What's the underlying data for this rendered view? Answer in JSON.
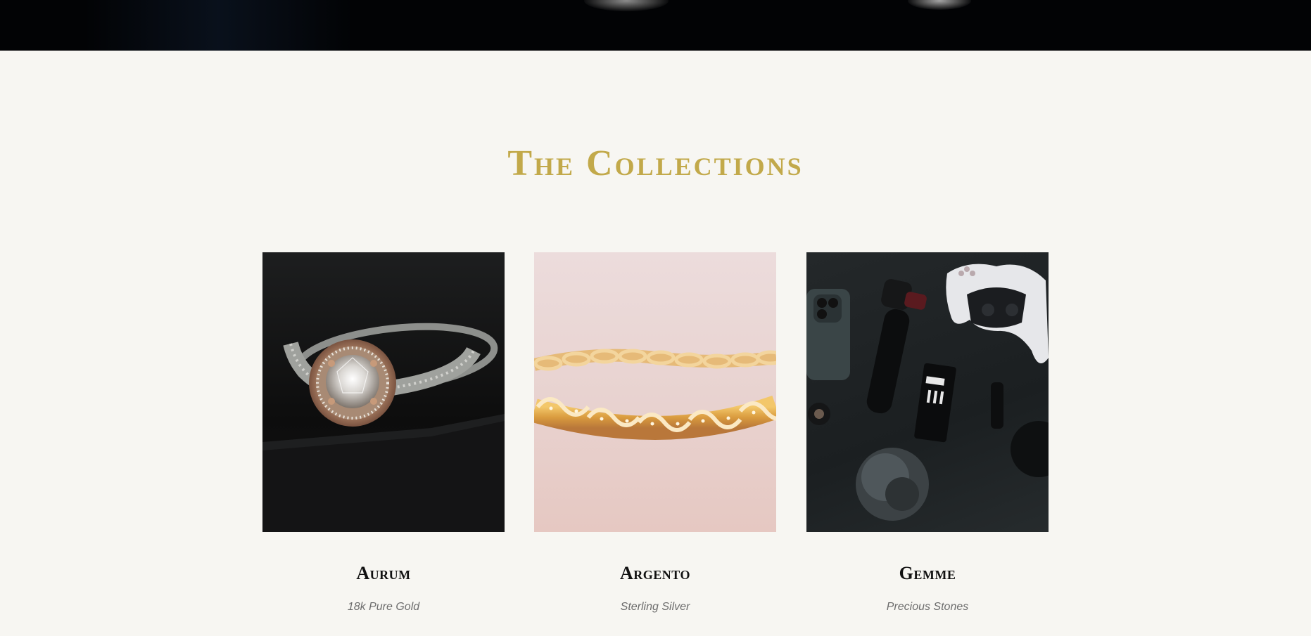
{
  "section": {
    "title": "The Collections"
  },
  "collections": [
    {
      "name": "Aurum",
      "subtitle": "18k Pure Gold",
      "image_icon": "ring-photo"
    },
    {
      "name": "Argento",
      "subtitle": "Sterling Silver",
      "image_icon": "bracelet-photo"
    },
    {
      "name": "Gemme",
      "subtitle": "Precious Stones",
      "image_icon": "gadgets-photo"
    }
  ],
  "colors": {
    "page_background": "#f7f6f2",
    "title_gold": "#c2a94a",
    "heading_dark": "#111111",
    "subtitle_gray": "#6d6d6d",
    "hero_background": "#020305"
  }
}
